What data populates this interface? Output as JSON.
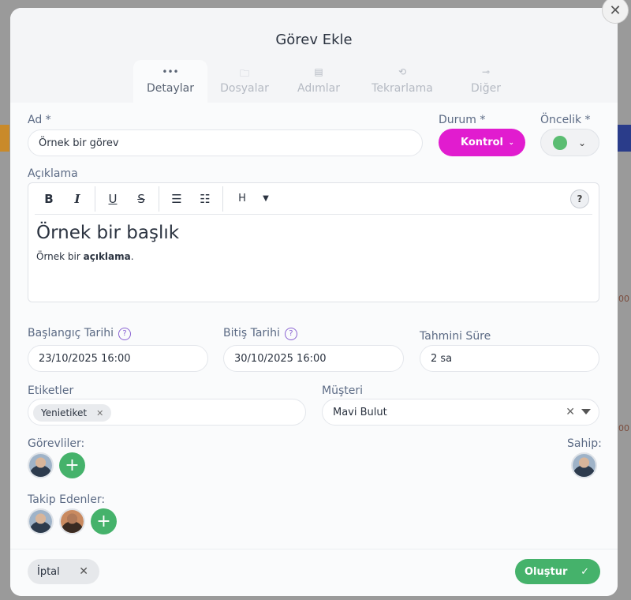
{
  "modal": {
    "title": "Görev Ekle",
    "close_icon": "close-icon"
  },
  "tabs": [
    {
      "label": "Detaylar",
      "icon": "more-horiz-icon",
      "glyph": "•••",
      "active": true
    },
    {
      "label": "Dosyalar",
      "icon": "folder-icon",
      "glyph": "🗀"
    },
    {
      "label": "Adımlar",
      "icon": "clipboard-icon",
      "glyph": "▤"
    },
    {
      "label": "Tekrarlama",
      "icon": "repeat-icon",
      "glyph": "⟲"
    },
    {
      "label": "Diğer",
      "icon": "settings-slider-icon",
      "glyph": "⊸"
    }
  ],
  "form": {
    "name_label": "Ad *",
    "name_value": "Örnek bir görev",
    "status_label": "Durum *",
    "status_value": "Kontrol",
    "status_color": "#e11ccf",
    "priority_label": "Öncelik *",
    "priority_color": "#5bbd72",
    "description_label": "Açıklama",
    "editor": {
      "heading": "Örnek bir başlık",
      "para_prefix": "Örnek bir ",
      "para_bold": "açıklama",
      "para_suffix": ".",
      "toolbar": {
        "bold": "B",
        "italic": "I",
        "underline": "U",
        "strike": "S",
        "heading": "H",
        "help": "?"
      }
    },
    "start_label": "Başlangıç Tarihi",
    "start_value": "23/10/2025 16:00",
    "end_label": "Bitiş Tarihi",
    "end_value": "30/10/2025 16:00",
    "estimate_label": "Tahmini Süre",
    "estimate_value": "2 sa",
    "tags_label": "Etiketler",
    "tags": [
      "Yenietiket"
    ],
    "customer_label": "Müşteri",
    "customer_value": "Mavi Bulut",
    "assignees_label": "Görevliler:",
    "owner_label": "Sahip:",
    "followers_label": "Takip Edenler:"
  },
  "footer": {
    "cancel_label": "İptal",
    "create_label": "Oluştur"
  },
  "bg": {
    "stub1": "00",
    "stub2": ":00"
  }
}
